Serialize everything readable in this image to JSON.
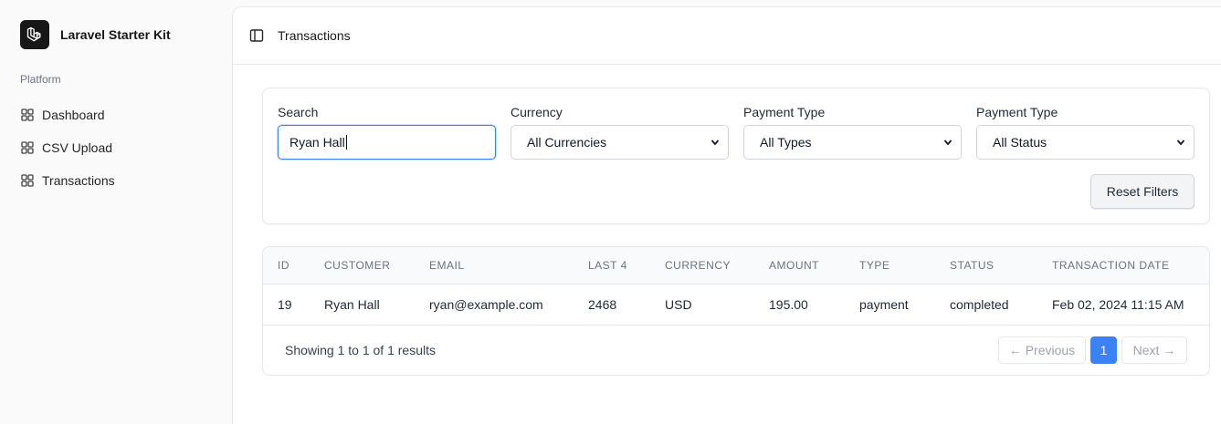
{
  "app": {
    "name": "Laravel Starter Kit",
    "logo_icon": "laravel-logo-icon"
  },
  "sidebar": {
    "group_label": "Platform",
    "items": [
      {
        "label": "Dashboard",
        "icon": "layout-grid-icon"
      },
      {
        "label": "CSV Upload",
        "icon": "layout-grid-icon"
      },
      {
        "label": "Transactions",
        "icon": "layout-grid-icon"
      }
    ]
  },
  "header": {
    "toggle_icon": "panel-left-icon",
    "breadcrumb": "Transactions"
  },
  "filters": {
    "search": {
      "label": "Search",
      "value": "Ryan Hall"
    },
    "currency": {
      "label": "Currency",
      "selected": "All Currencies"
    },
    "payment_type": {
      "label": "Payment Type",
      "selected": "All Types"
    },
    "status": {
      "label": "Payment Type",
      "selected": "All Status"
    },
    "reset_label": "Reset Filters"
  },
  "table": {
    "columns": [
      "ID",
      "CUSTOMER",
      "EMAIL",
      "LAST 4",
      "CURRENCY",
      "AMOUNT",
      "TYPE",
      "STATUS",
      "TRANSACTION DATE"
    ],
    "rows": [
      {
        "id": "19",
        "customer": "Ryan Hall",
        "email": "ryan@example.com",
        "last4": "2468",
        "currency": "USD",
        "amount": "195.00",
        "type": "payment",
        "status": "completed",
        "date": "Feb 02, 2024 11:15 AM"
      }
    ]
  },
  "pagination": {
    "showing": "Showing 1 to 1 of 1 results",
    "prev": "← Previous",
    "current": "1",
    "next": "Next →"
  },
  "colors": {
    "accent": "#3b82f6",
    "sidebar_bg": "#fafafa",
    "logo_bg": "#171717"
  }
}
